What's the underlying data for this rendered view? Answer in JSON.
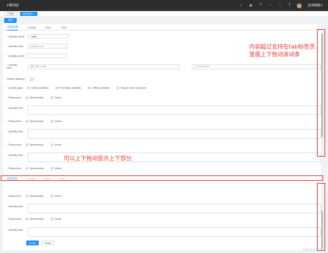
{
  "header": {
    "title": "Fi和活记",
    "icons": [
      "search-icon",
      "github-icon",
      "question-icon",
      "bell-icon",
      "fullscreen-icon",
      "font-size-icon"
    ],
    "user_name": "台湾刺桐 ▾"
  },
  "tags": [
    {
      "label": "工作台",
      "active": false
    },
    {
      "label": "动态表记 ×",
      "active": true
    }
  ],
  "toolbar": {
    "primary_label": "添加"
  },
  "tabs": [
    {
      "label": "活动信息",
      "active": true
    },
    {
      "label": "Config",
      "active": false
    },
    {
      "label": "Role",
      "active": false
    },
    {
      "label": "Task",
      "active": false
    }
  ],
  "form": {
    "activity_name": {
      "label": "Activity name",
      "value": "Hello"
    },
    "activity_zone": {
      "label": "Activity zone",
      "placeholder": "Activity zone"
    },
    "activity_count": {
      "label": "Activity count",
      "placeholder": ""
    },
    "activity_time": {
      "label": "Activity time",
      "date_placeholder": "Pick a date",
      "time_placeholder": "Pick a time",
      "separator": "-"
    },
    "instant_delivery": {
      "label": "Instant delivery"
    },
    "activity_type": {
      "label": "Activity type",
      "options": [
        "Online activities",
        "Promotion activities",
        "Offline activities",
        "Simple brand exposure"
      ]
    },
    "resources_label": "Resources",
    "resources_options": [
      "Sponsorship",
      "Venue"
    ],
    "activity_form_label": "Activity form"
  },
  "ghost_tabs": [
    "活动信息",
    "Config",
    "Role",
    "Task"
  ],
  "actions": {
    "create": "Create",
    "reset": "Reset"
  },
  "annotations": {
    "right_note": "内容超过支持在tab标签页\n里面上下拖动滚动条",
    "mid_note": "可以上下拖动显示上下部分"
  },
  "watermark": "CSDN @台湾刺桐",
  "colors": {
    "accent": "#1890ff",
    "annotation": "#e53935",
    "header": "#2d2d2d"
  }
}
